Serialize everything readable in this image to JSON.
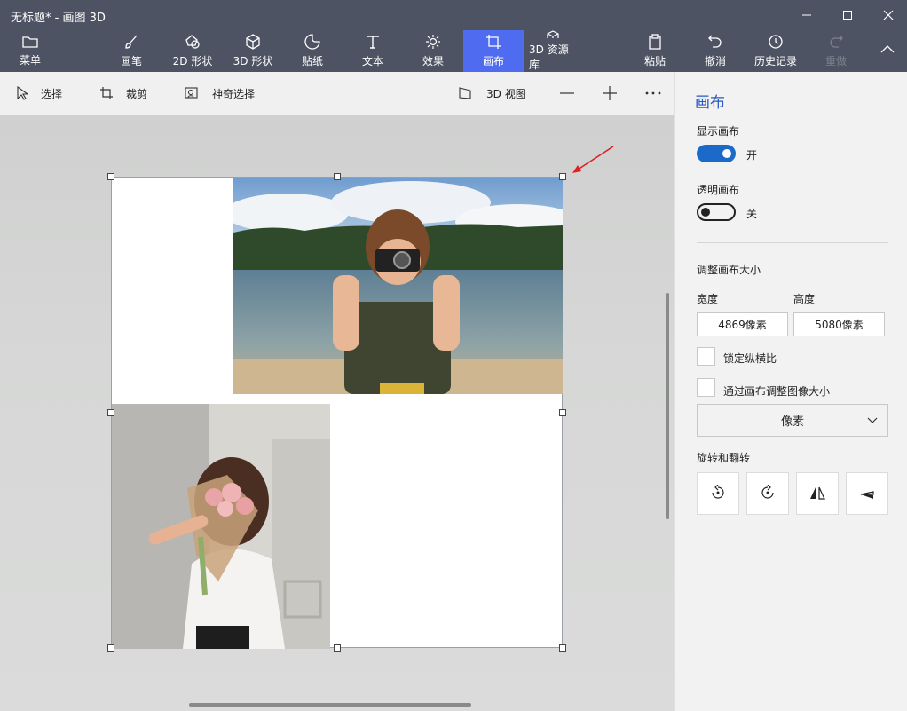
{
  "window": {
    "title": "无标题* - 画图 3D"
  },
  "ribbon": {
    "menu": "菜单",
    "brushes": "画笔",
    "shapes2d": "2D 形状",
    "shapes3d": "3D 形状",
    "stickers": "贴纸",
    "text": "文本",
    "effects": "效果",
    "canvas": "画布",
    "library3d": "3D 资源库",
    "paste": "粘贴",
    "undo": "撤消",
    "history": "历史记录",
    "redo": "重做"
  },
  "toolbar": {
    "select": "选择",
    "crop": "裁剪",
    "magic_select": "神奇选择",
    "view3d": "3D 视图"
  },
  "panel": {
    "title": "画布",
    "show_canvas_label": "显示画布",
    "show_canvas_state": "开",
    "transparent_canvas_label": "透明画布",
    "transparent_canvas_state": "关",
    "resize_heading": "调整画布大小",
    "width_label": "宽度",
    "height_label": "高度",
    "width_value": "4869像素",
    "height_value": "5080像素",
    "lock_aspect_label": "锁定纵横比",
    "resize_image_label": "通过画布调整图像大小",
    "unit_selected": "像素",
    "rotate_heading": "旋转和翻转"
  },
  "colors": {
    "chrome": "#4d5362",
    "accent": "#4f6bef",
    "toggle_on": "#1b6ac9",
    "title_blue": "#2a58c2"
  }
}
